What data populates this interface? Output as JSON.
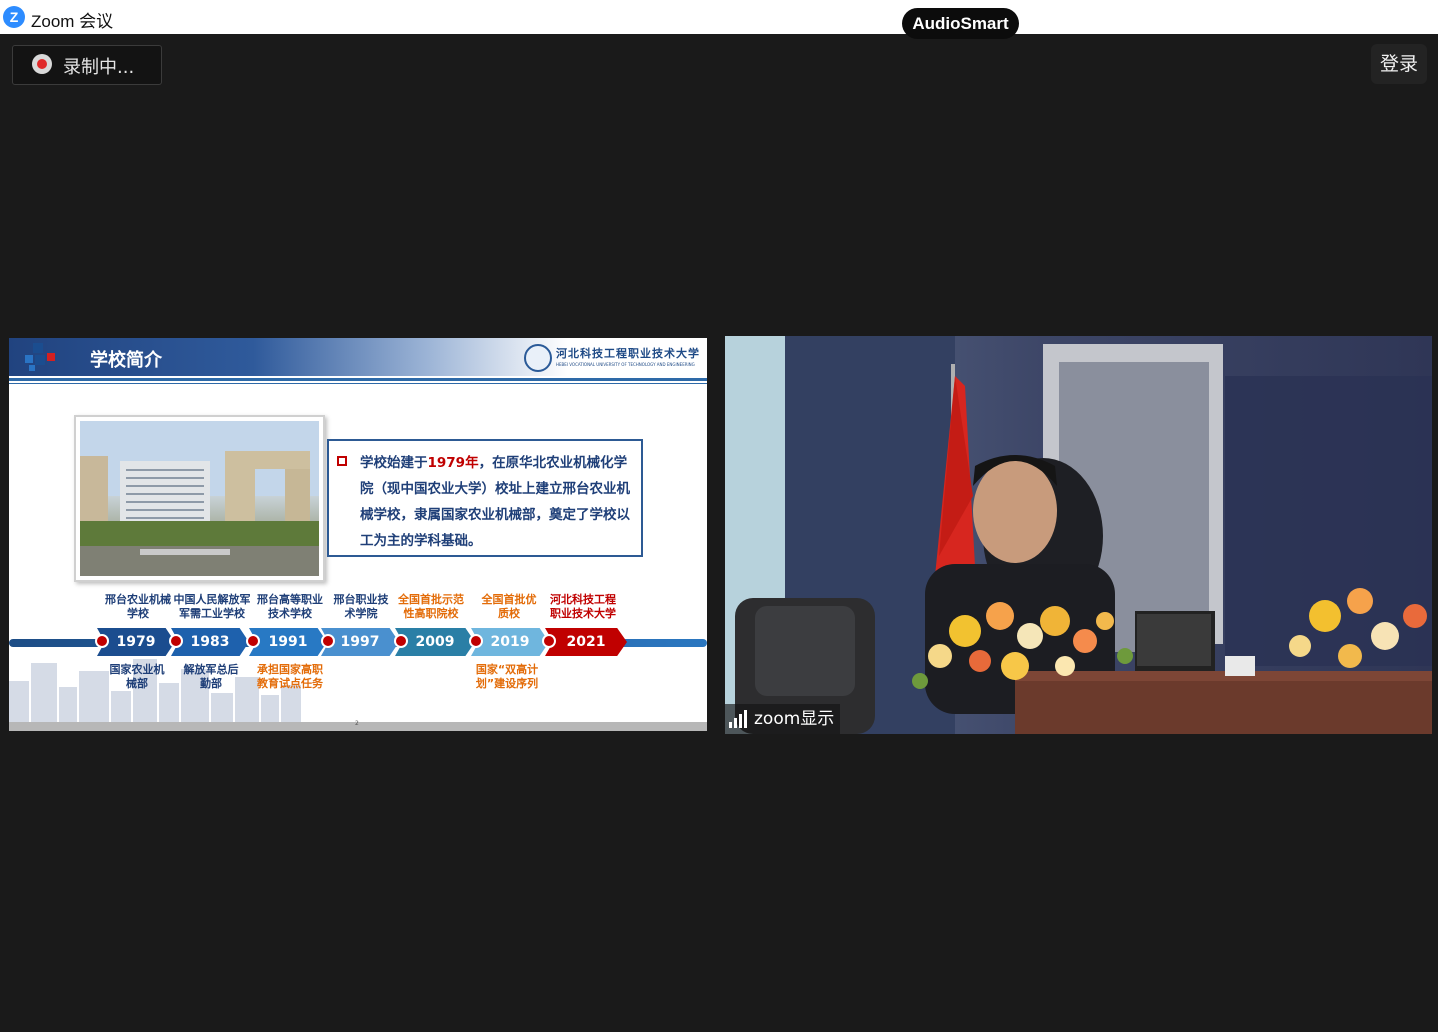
{
  "window": {
    "app_title": "Zoom 会议",
    "audiosmart_label": "AudioSmart"
  },
  "toolbar": {
    "recording_label": "录制中...",
    "login_label": "登录"
  },
  "shared_slide": {
    "title": "学校简介",
    "university_name": "河北科技工程职业技术大学",
    "university_sub": "HEBEI VOCATIONAL UNIVERSITY OF TECHNOLOGY AND ENGINEERING",
    "body_pre": "学校始建于",
    "body_highlight": "1979年",
    "body_post": "，在原华北农业机械化学院（现中国农业大学）校址上建立邢台农业机械学校，隶属国家农业机械部，奠定了学校以工为主的学科基础。",
    "page_number": "2",
    "timeline": [
      {
        "year": "1979",
        "top_label": "邢台农业机械学校",
        "bottom_label": "国家农业机械部"
      },
      {
        "year": "1983",
        "top_label": "中国人民解放军军需工业学校",
        "bottom_label": "解放军总后勤部"
      },
      {
        "year": "1991",
        "top_label": "邢台高等职业技术学校",
        "bottom_label": "承担国家高职教育试点任务"
      },
      {
        "year": "1997",
        "top_label": "邢台职业技术学院",
        "bottom_label": ""
      },
      {
        "year": "2009",
        "top_label": "全国首批示范性高职院校",
        "bottom_label": ""
      },
      {
        "year": "2019",
        "top_label": "全国首批优质校",
        "bottom_label": "国家“双高计划”建设序列"
      },
      {
        "year": "2021",
        "top_label": "河北科技工程职业技术大学",
        "bottom_label": ""
      }
    ]
  },
  "video": {
    "participant_name": "zoom显示"
  },
  "colors": {
    "zoom_blue": "#2d8cff",
    "recording_red": "#e02a2a",
    "slide_navy": "#1f3f78",
    "slide_red": "#c00000",
    "slide_orange": "#e36c09"
  }
}
